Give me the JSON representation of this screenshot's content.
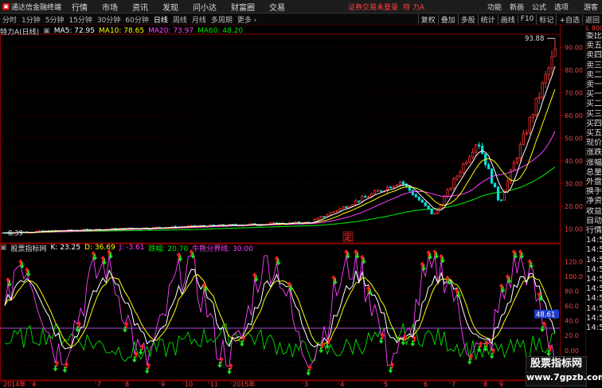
{
  "menubar": {
    "app_name": "通达信金融终端",
    "items": [
      "行情",
      "市场",
      "资讯",
      "发现",
      "问小达",
      "财富圈",
      "交易"
    ],
    "warning": "证券交易未登录",
    "stock_name": "特 力A",
    "right_items": [
      "功能",
      "新画",
      "公式",
      "选项",
      "游客"
    ]
  },
  "toolbar": {
    "timeframes": [
      "分时",
      "1分钟",
      "5分钟",
      "15分钟",
      "30分钟",
      "60分钟",
      "日线",
      "周线",
      "月线",
      "多周期",
      "更多"
    ],
    "active_timeframe": "日线",
    "buttons": [
      "复权",
      "叠加",
      "多股",
      "统计",
      "画线",
      "F10",
      "标记",
      "+自选",
      "返回"
    ]
  },
  "chart_title": {
    "stock": "特力A(日线)",
    "ma5": "MA5: 72.95",
    "ma10": "MA10: 78.65",
    "ma20": "MA20: 73.97",
    "ma60": "MA60: 48.20"
  },
  "indicator_title": {
    "name": "股票指标网",
    "k": "K: 23.25",
    "d": "D: 36.69",
    "j": "J: -3.61",
    "drop": "跌幅: 20.70",
    "bullbear": "牛熊分界线: 30.00"
  },
  "right_panel": {
    "top": "L 8000",
    "items": [
      "委比",
      "卖五",
      "卖四",
      "卖三",
      "卖二",
      "卖一",
      "买一",
      "买二",
      "买三",
      "买四",
      "买五",
      "现价",
      "涨跌",
      "涨幅",
      "总量",
      "外盘",
      "换手",
      "净资",
      "收益",
      "自动",
      "行情",
      "14:5",
      "14:5",
      "14:5",
      "14:5",
      "14:5",
      "14:5",
      "14:5",
      "14:5",
      "14:5",
      "14:5"
    ]
  },
  "price_axis": [
    "90.00",
    "80.00",
    "70.00",
    "60.00",
    "50.00",
    "40.00",
    "30.00",
    "20.00",
    "10.00"
  ],
  "indicator_axis": [
    "120.0",
    "100.0",
    "80.0",
    "60.0",
    "40.0",
    "20.0",
    "0.00",
    "-20.0"
  ],
  "indicator_marker": "48.61",
  "high_label": "93.88",
  "low_label": "8.39",
  "ding_marker": "定",
  "date_axis": [
    "2014年",
    "4",
    "7",
    "8",
    "9",
    "10",
    "11",
    "2015年",
    "3",
    "4",
    "5",
    "6",
    "7",
    "8",
    "9"
  ],
  "watermark": {
    "line1": "股票指标网",
    "line2": "www.7gpzb.com"
  },
  "colors": {
    "up": "#ff3232",
    "down": "#00e0e0",
    "ma5": "#ffffff",
    "ma10": "#ffff00",
    "ma20": "#ff40ff",
    "ma60": "#00e000",
    "grid": "#8b0000",
    "k_line": "#ffffff",
    "d_line": "#ffff00",
    "j_line": "#ff40ff",
    "drop_line": "#00e000",
    "bullbear_line": "#a040c0"
  }
}
